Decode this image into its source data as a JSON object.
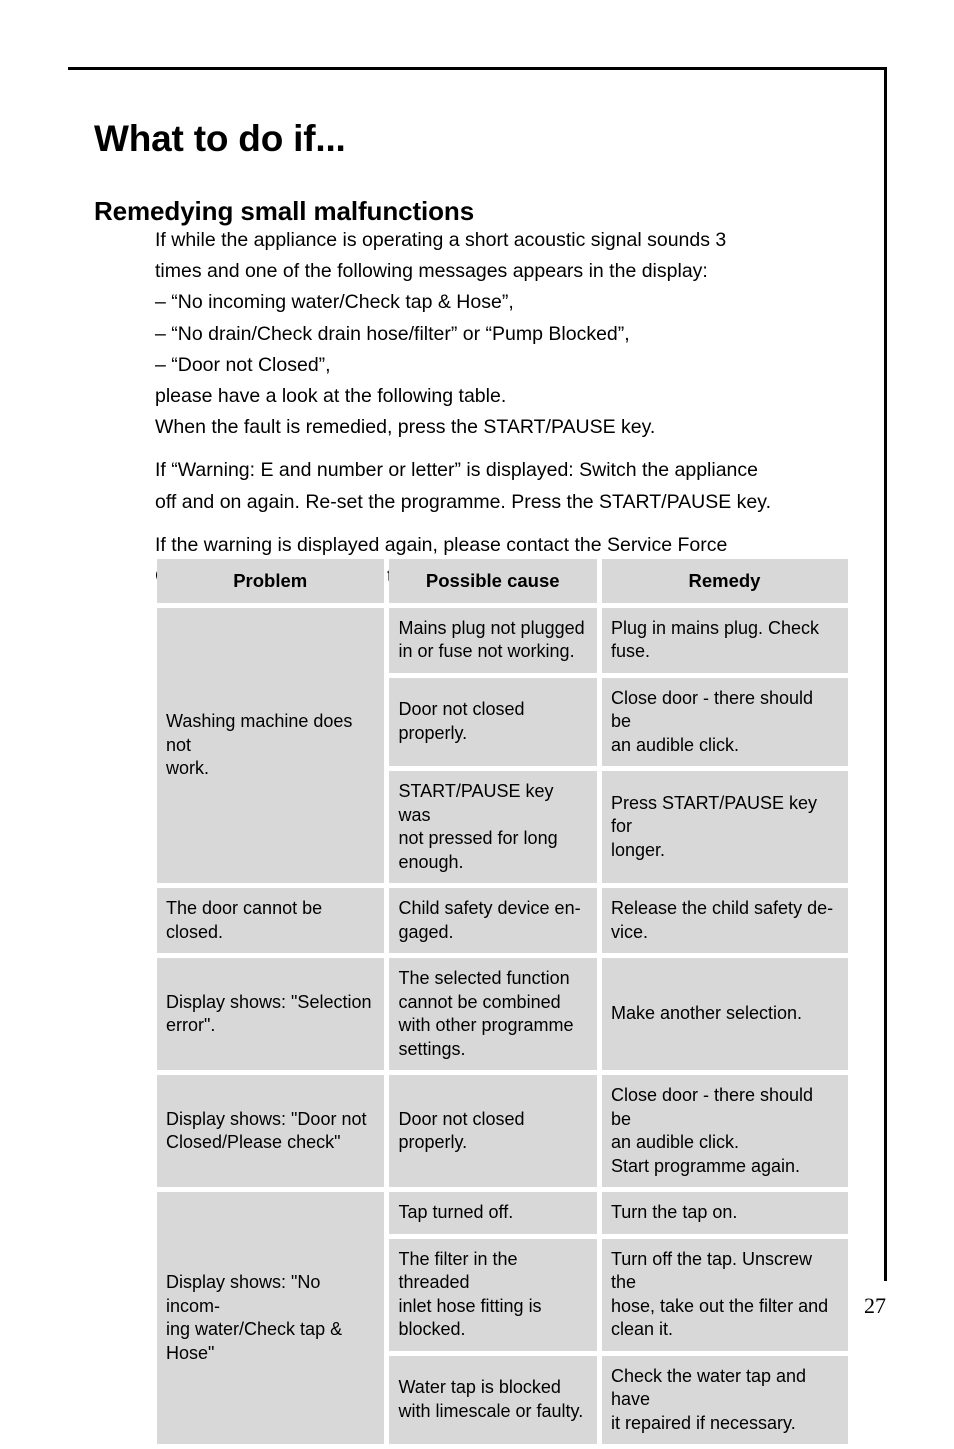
{
  "page": {
    "title": "What to do if...",
    "section_title": "Remedying small malfunctions",
    "page_number": "27",
    "rule_color": "#000000",
    "cell_background": "#d8d8d8",
    "text_color": "#000000"
  },
  "intro": {
    "paragraph1_lines": [
      "If while the appliance is operating a short acoustic signal sounds 3",
      "times and one of the following messages appears in the display:",
      "– \"No incoming water/Check tap &amp; Hose\",",
      "– \"No drain/Check drain hose/filter\" or \"Pump Blocked\",",
      "– \"Door not Closed\",",
      "please have a look at the following table.",
      "When the fault is remedied, press the START/PAUSE key."
    ],
    "paragraph1_line1": "If while the appliance is operating a short acoustic signal sounds 3",
    "paragraph1_line2": "times and one of the following messages appears in the display:",
    "paragraph1_line3": "– “No incoming water/Check tap & Hose”,",
    "paragraph1_line4": "– “No drain/Check drain hose/filter” or “Pump Blocked”,",
    "paragraph1_line5": "– “Door not Closed”,",
    "paragraph1_line6": "please have a look at the following table.",
    "paragraph1_line7": "When the fault is remedied, press the START/PAUSE key.",
    "paragraph2_line1": "If “Warning: E and number or letter” is displayed: Switch the appliance",
    "paragraph2_line2": "off and on again. Re-set the programme. Press the START/PAUSE key.",
    "paragraph3_line1": "If the warning is displayed again, please contact the Service Force",
    "paragraph3_line2": "Centre and inform them of the warning."
  },
  "table": {
    "headers": {
      "problem": "Problem",
      "cause": "Possible cause",
      "remedy": "Remedy"
    },
    "rows": [
      {
        "problem": "Washing machine does not work.",
        "problem_rowspan": 3,
        "cause": "Mains plug not plugged in or fuse not working.",
        "remedy": "Plug in mains plug. Check fuse."
      },
      {
        "problem": null,
        "cause": "Door not closed properly.",
        "remedy": "Close door - there should be an audible click."
      },
      {
        "problem": null,
        "cause": "START/PAUSE key was not pressed for long enough.",
        "remedy": "Press START/PAUSE key for longer."
      },
      {
        "problem": "The door cannot be closed.",
        "problem_rowspan": 1,
        "cause": "Child safety device en-gaged.",
        "remedy": "Release the child safety de-vice."
      },
      {
        "problem": "Display shows: \"Selection error\".",
        "problem_rowspan": 1,
        "cause": "The selected function cannot be combined with other programme settings.",
        "remedy": "Make another selection."
      },
      {
        "problem": "Display shows: \"Door not Closed/Please check\"",
        "problem_rowspan": 1,
        "cause": "Door not closed properly.",
        "remedy": "Close door - there should be an audible click. Start programme again."
      },
      {
        "problem": "Display shows: \"No incom-ing water/Check tap & Hose\"",
        "problem_rowspan": 3,
        "cause": "Tap turned off.",
        "remedy": "Turn the tap on."
      },
      {
        "problem": null,
        "cause": "The filter in the threaded inlet hose fitting is blocked.",
        "remedy": "Turn off the tap. Unscrew the hose, take out the filter and clean it."
      },
      {
        "problem": null,
        "cause": "Water tap is blocked with limescale or faulty.",
        "remedy": "Check the water tap and have it repaired if necessary."
      }
    ],
    "cells": {
      "r1_problem_l1": "Washing machine does not",
      "r1_problem_l2": "work.",
      "r1_cause_l1": "Mains plug not plugged",
      "r1_cause_l2": "in or fuse not working.",
      "r1_remedy_l1": "Plug in mains plug. Check",
      "r1_remedy_l2": "fuse.",
      "r2_cause_l1": "Door not closed properly.",
      "r2_remedy_l1": "Close door - there should be",
      "r2_remedy_l2": "an audible click.",
      "r3_cause_l1": "START/PAUSE key was",
      "r3_cause_l2": "not pressed for long",
      "r3_cause_l3": "enough.",
      "r3_remedy_l1": "Press START/PAUSE key for",
      "r3_remedy_l2": "longer.",
      "r4_problem_l1": "The door cannot be closed.",
      "r4_cause_l1": "Child safety device en-",
      "r4_cause_l2": "gaged.",
      "r4_remedy_l1": "Release the child safety de-",
      "r4_remedy_l2": "vice.",
      "r5_problem_l1": "Display shows: \"Selection",
      "r5_problem_l2": "error\".",
      "r5_cause_l1": "The selected function",
      "r5_cause_l2": "cannot be combined",
      "r5_cause_l3": "with other programme",
      "r5_cause_l4": "settings.",
      "r5_remedy_l1": "Make another selection.",
      "r6_problem_l1": "Display shows: \"Door not",
      "r6_problem_l2": "Closed/Please check\"",
      "r6_cause_l1": "Door not closed properly.",
      "r6_remedy_l1": "Close door - there should be",
      "r6_remedy_l2": "an audible click.",
      "r6_remedy_l3": "Start programme again.",
      "r7_problem_l1": "Display shows: \"No incom-",
      "r7_problem_l2": "ing water/Check tap &",
      "r7_problem_l3": "Hose\"",
      "r7_cause_l1": "Tap turned off.",
      "r7_remedy_l1": "Turn the tap on.",
      "r8_cause_l1": "The filter in the threaded",
      "r8_cause_l2": "inlet hose fitting is",
      "r8_cause_l3": "blocked.",
      "r8_remedy_l1": "Turn off the tap. Unscrew the",
      "r8_remedy_l2": "hose, take out the filter and",
      "r8_remedy_l3": "clean it.",
      "r9_cause_l1": "Water tap is blocked",
      "r9_cause_l2": "with limescale or faulty.",
      "r9_remedy_l1": "Check the water tap and have",
      "r9_remedy_l2": "it repaired if necessary."
    }
  }
}
